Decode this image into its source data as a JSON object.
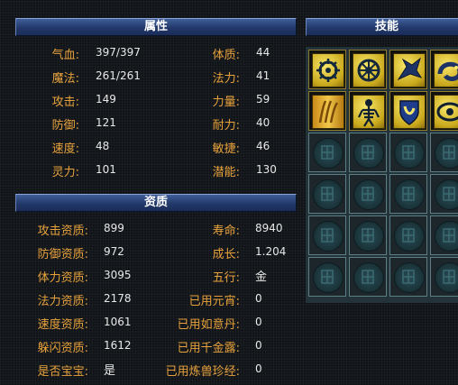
{
  "attributes_panel": {
    "title": "属性",
    "left": [
      {
        "label": "气血:",
        "value": "397/397"
      },
      {
        "label": "魔法:",
        "value": "261/261"
      },
      {
        "label": "攻击:",
        "value": "149"
      },
      {
        "label": "防御:",
        "value": "121"
      },
      {
        "label": "速度:",
        "value": "48"
      },
      {
        "label": "灵力:",
        "value": "101"
      }
    ],
    "right": [
      {
        "label": "体质:",
        "value": "44"
      },
      {
        "label": "法力:",
        "value": "41"
      },
      {
        "label": "力量:",
        "value": "59"
      },
      {
        "label": "耐力:",
        "value": "40"
      },
      {
        "label": "敏捷:",
        "value": "46"
      },
      {
        "label": "潜能:",
        "value": "130"
      }
    ]
  },
  "aptitude_panel": {
    "title": "资质",
    "left": [
      {
        "label": "攻击资质:",
        "value": "899"
      },
      {
        "label": "防御资质:",
        "value": "972"
      },
      {
        "label": "体力资质:",
        "value": "3095"
      },
      {
        "label": "法力资质:",
        "value": "2178"
      },
      {
        "label": "速度资质:",
        "value": "1061"
      },
      {
        "label": "躲闪资质:",
        "value": "1612"
      },
      {
        "label": "是否宝宝:",
        "value": "是"
      }
    ],
    "right": [
      {
        "label": "寿命:",
        "value": "8940"
      },
      {
        "label": "成长:",
        "value": "1.204"
      },
      {
        "label": "五行:",
        "value": "金"
      },
      {
        "label": "已用元宵:",
        "value": "0"
      },
      {
        "label": "已用如意丹:",
        "value": "0"
      },
      {
        "label": "已用千金露:",
        "value": "0"
      },
      {
        "label": "已用炼兽珍经:",
        "value": "0"
      }
    ]
  },
  "skills_panel": {
    "title": "技能",
    "skills": [
      {
        "icon": "compass-skill-icon"
      },
      {
        "icon": "wheel-skill-icon"
      },
      {
        "icon": "bird-skill-icon"
      },
      {
        "icon": "serpent-skill-icon"
      },
      {
        "icon": "claw-skill-icon"
      },
      {
        "icon": "skeleton-skill-icon"
      },
      {
        "icon": "shield-skill-icon"
      },
      {
        "icon": "eye-skill-icon"
      }
    ],
    "empty_slots": 16
  },
  "colors": {
    "label": "#e8a23c",
    "value": "#e8e8e8",
    "title_bar": "#22386a"
  }
}
